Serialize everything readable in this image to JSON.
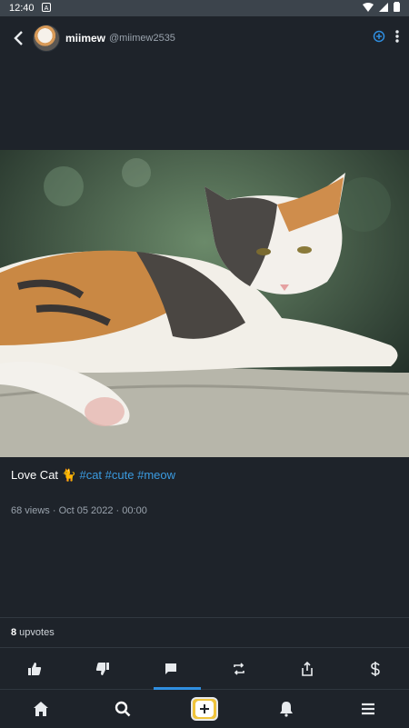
{
  "status_bar": {
    "time": "12:40"
  },
  "post": {
    "author_name": "miimew",
    "author_handle": "@miimew2535",
    "caption_text": "Love Cat ",
    "caption_emoji": "🐈",
    "hashtags": [
      "#cat",
      "#cute",
      "#meow"
    ],
    "meta": "68 views · Oct 05 2022 · 00:00",
    "upvote_count": "8",
    "upvote_label": " upvotes"
  },
  "icons": {
    "back": "chevron-left-icon",
    "add": "plus-circle-icon",
    "more": "more-vert-icon",
    "like": "thumb-up-icon",
    "dislike": "thumb-down-icon",
    "comment": "comment-icon",
    "repost": "repeat-icon",
    "share": "share-icon",
    "tip": "dollar-icon"
  },
  "colors": {
    "background": "#1e232a",
    "accent": "#2f8ee0",
    "hashtag": "#3b9be0",
    "compose_yellow": "#f0c43c"
  }
}
